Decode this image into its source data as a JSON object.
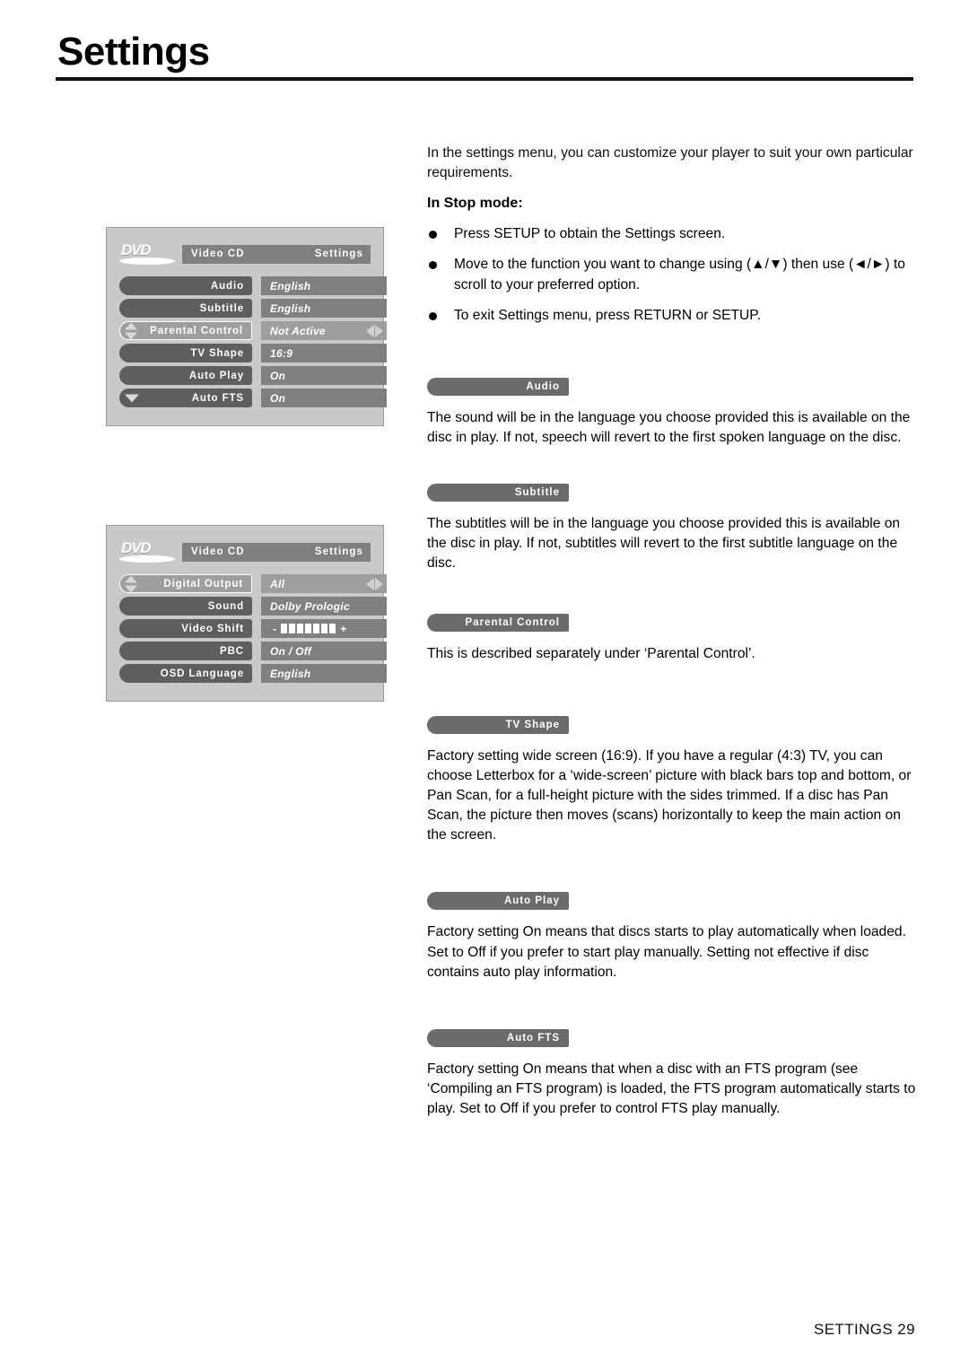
{
  "page": {
    "title": "Settings",
    "footer": "SETTINGS 29"
  },
  "intro": {
    "paragraph": "In the settings menu, you can customize your player to suit your own particular requirements.",
    "subhead": "In Stop mode:",
    "bullets": [
      "Press SETUP to obtain the Settings screen.",
      "Move to the function you want to change using (▲/▼) then use (◄/►) to scroll to your preferred option.",
      "To exit Settings menu, press RETURN or SETUP."
    ]
  },
  "osd_screens": [
    {
      "logo": "DVD",
      "disc_type": "Video CD",
      "screen_title": "Settings",
      "rows": [
        {
          "label": "Audio",
          "value": "English",
          "selected": false,
          "marker": "none",
          "lr_arrows": false
        },
        {
          "label": "Subtitle",
          "value": "English",
          "selected": false,
          "marker": "none",
          "lr_arrows": false
        },
        {
          "label": "Parental Control",
          "value": "Not Active",
          "selected": true,
          "marker": "updown",
          "lr_arrows": true
        },
        {
          "label": "TV Shape",
          "value": "16:9",
          "selected": false,
          "marker": "none",
          "lr_arrows": false
        },
        {
          "label": "Auto Play",
          "value": "On",
          "selected": false,
          "marker": "none",
          "lr_arrows": false
        },
        {
          "label": "Auto FTS",
          "value": "On",
          "selected": false,
          "marker": "down",
          "lr_arrows": false
        }
      ]
    },
    {
      "logo": "DVD",
      "disc_type": "Video CD",
      "screen_title": "Settings",
      "rows": [
        {
          "label": "Digital Output",
          "value": "All",
          "selected": true,
          "marker": "updown",
          "lr_arrows": true
        },
        {
          "label": "Sound",
          "value": "Dolby Prologic",
          "selected": false,
          "marker": "none",
          "lr_arrows": false
        },
        {
          "label": "Video Shift",
          "value": "",
          "selected": false,
          "marker": "none",
          "lr_arrows": false,
          "gauge": {
            "minus": "-",
            "plus": "+",
            "blocks": 7
          }
        },
        {
          "label": "PBC",
          "value": "On / Off",
          "selected": false,
          "marker": "none",
          "lr_arrows": false
        },
        {
          "label": "OSD Language",
          "value": "English",
          "selected": false,
          "marker": "none",
          "lr_arrows": false
        }
      ]
    }
  ],
  "sections": [
    {
      "pill": "Audio",
      "body": "The sound will be in the language you choose provided this is available on the disc in play. If not, speech will revert to the first spoken language on the disc."
    },
    {
      "pill": "Subtitle",
      "body": "The subtitles will be in the language you choose provided this is available on the disc in play. If not, subtitles will revert to the first subtitle language on the disc."
    },
    {
      "pill": "Parental Control",
      "body": "This is described separately under ‘Parental Control’."
    },
    {
      "pill": "TV Shape",
      "body": "Factory setting wide screen (16:9). If you have a regular (4:3) TV, you can choose Letterbox for a ‘wide-screen’ picture with black bars top and bottom, or Pan Scan, for a full-height picture with the sides trimmed. If a disc has Pan Scan, the picture then moves (scans) horizontally to keep the main action on the screen."
    },
    {
      "pill": "Auto Play",
      "body": "Factory setting On means that discs starts to play automatically when loaded. Set to Off if you prefer to start play manually. Setting not effective if disc contains auto play information."
    },
    {
      "pill": "Auto FTS",
      "body": "Factory setting On means that when a disc with an FTS program (see ‘Compiling an FTS program) is loaded, the FTS program automatically starts to play. Set to Off if you prefer to control FTS play manually."
    }
  ],
  "colors": {
    "osd_background": "#c9c9c9",
    "osd_label": "#5e5e5e",
    "osd_value": "#808080",
    "osd_selected": "#9e9e9e",
    "pill": "#6b6b6b",
    "text": "#0d0d0d"
  }
}
